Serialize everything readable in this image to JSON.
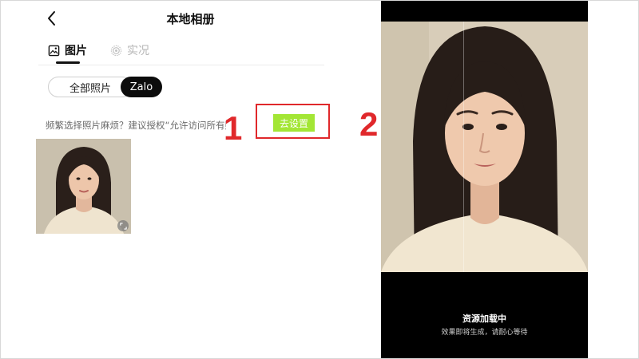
{
  "header": {
    "title": "本地相册"
  },
  "tabs": [
    {
      "label": "图片",
      "active": true,
      "icon": "image-icon"
    },
    {
      "label": "实况",
      "active": false,
      "icon": "live-photo-icon"
    }
  ],
  "filters": [
    {
      "label": "全部照片",
      "selected": false
    },
    {
      "label": "Zalo",
      "selected": true
    }
  ],
  "permission": {
    "hint": "频繁选择照片麻烦？建议授权“允许访问所有照片”",
    "button_label": "去设置",
    "button_color": "#a3e635"
  },
  "annotations": {
    "marker_1": "1",
    "marker_2": "2",
    "color": "#e0282b"
  },
  "photos": [
    {
      "description_icon": "portrait-photo",
      "badge_icon": "expand-icon"
    }
  ],
  "preview": {
    "loading_title": "资源加载中",
    "loading_subtitle": "效果即将生成，请耐心等待"
  }
}
